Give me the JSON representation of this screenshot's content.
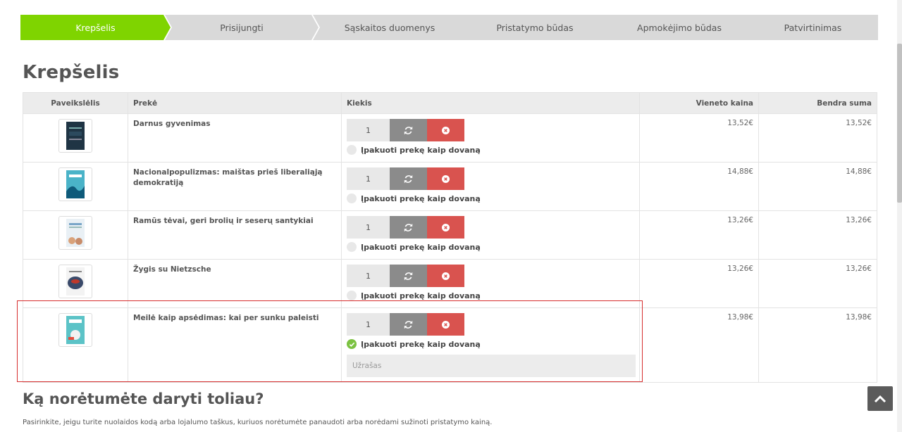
{
  "steps": [
    {
      "label": "Krepšelis",
      "active": true
    },
    {
      "label": "Prisijungti",
      "active": false
    },
    {
      "label": "Sąskaitos duomenys",
      "active": false
    },
    {
      "label": "Pristatymo būdas",
      "active": false
    },
    {
      "label": "Apmokėjimo būdas",
      "active": false
    },
    {
      "label": "Patvirtinimas",
      "active": false
    }
  ],
  "page_title": "Krepšelis",
  "table": {
    "headers": {
      "image": "Paveikslėlis",
      "product": "Prekė",
      "quantity": "Kiekis",
      "unit_price": "Vieneto kaina",
      "total": "Bendra suma"
    },
    "gift_label": "Įpakuoti prekę kaip dovaną",
    "rows": [
      {
        "name": "Darnus gyvenimas",
        "qty": "1",
        "unit_price": "13,52€",
        "total": "13,52€",
        "gift": false
      },
      {
        "name": "Nacionalpopulizmas: maištas prieš liberaliąją demokratiją",
        "qty": "1",
        "unit_price": "14,88€",
        "total": "14,88€",
        "gift": false
      },
      {
        "name": "Ramūs tėvai, geri brolių ir seserų santykiai",
        "qty": "1",
        "unit_price": "13,26€",
        "total": "13,26€",
        "gift": false
      },
      {
        "name": "Žygis su Nietzsche",
        "qty": "1",
        "unit_price": "13,26€",
        "total": "13,26€",
        "gift": false
      },
      {
        "name": "Meilė kaip apsėdimas: kai per sunku paleisti",
        "qty": "1",
        "unit_price": "13,98€",
        "total": "13,98€",
        "gift": true
      }
    ],
    "note_placeholder": "Užrašas"
  },
  "next_section": {
    "title": "Ką norėtumėte daryti toliau?",
    "description": "Pasirinkite, jeigu turite nuolaidos kodą arba lojalumo taškus, kuriuos norėtumėte panaudoti arba norėdami sužinoti pristatymo kainą."
  },
  "colors": {
    "active_step": "#7fd400",
    "inactive_step": "#d9d9d9",
    "refresh_button": "#8b8b8b",
    "remove_button": "#d9534f",
    "gift_checked": "#7cc242",
    "highlight_border": "#d62d2d"
  },
  "icons": {
    "refresh": "refresh-icon",
    "remove": "close-circle-icon",
    "check": "check-icon",
    "scroll_top": "chevron-up-icon"
  }
}
